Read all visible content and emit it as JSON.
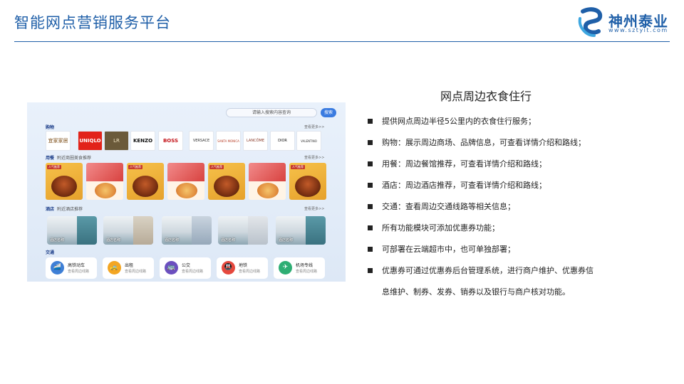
{
  "slide": {
    "title": "智能网点营销服务平台",
    "logo_name": "神州泰业",
    "logo_url": "www.sztyit.com"
  },
  "panel": {
    "search_placeholder": "请输入搜索内容查询",
    "search_button": "搜索",
    "shopping": {
      "label": "购物",
      "more": "查看更多>>",
      "brands": [
        "宜家家居",
        "UNIQLO",
        "LR",
        "KENZO",
        "BOSS",
        "VERSACE",
        "SANTA MONICA",
        "LANCÔME",
        "DIOR",
        "VALENTINO"
      ]
    },
    "dining": {
      "label": "用餐",
      "sub": "附近商圈美食推荐",
      "more": "查看更多>>",
      "tag": "人气推荐",
      "cards": [
        "pot",
        "pizza",
        "pot",
        "pizza",
        "pot",
        "pizza",
        "pot"
      ]
    },
    "hotel": {
      "label": "酒店",
      "sub": "附近酒店推荐",
      "more": "查看更多>>",
      "rooms": [
        "酒店名称",
        "酒店名称",
        "酒店名称",
        "酒店名称",
        "酒店名称"
      ]
    },
    "transport": {
      "label": "交通",
      "items": [
        {
          "title": "高铁动车",
          "sub": "查看周边线路",
          "color": "#3e7fd6",
          "icon": "train-icon",
          "glyph": "🚄"
        },
        {
          "title": "出租",
          "sub": "查看周边线路",
          "color": "#f3a623",
          "icon": "taxi-icon",
          "glyph": "🚕"
        },
        {
          "title": "公交",
          "sub": "查看周边线路",
          "color": "#6b4fbf",
          "icon": "bus-icon",
          "glyph": "🚌"
        },
        {
          "title": "地铁",
          "sub": "查看周边线路",
          "color": "#e5483d",
          "icon": "metro-icon",
          "glyph": "🚇"
        },
        {
          "title": "机场专线",
          "sub": "查看周边线路",
          "color": "#2eae74",
          "icon": "airplane-icon",
          "glyph": "✈"
        }
      ]
    }
  },
  "content": {
    "heading": "网点周边衣食住行",
    "bullets": [
      "提供网点周边半径5公里内的衣食住行服务；",
      "购物：展示周边商场、品牌信息，可查看详情介绍和路线；",
      "用餐：周边餐馆推荐，可查看详情介绍和路线；",
      "酒店：周边酒店推荐，可查看详情介绍和路线；",
      "交通：查看周边交通线路等相关信息；",
      "所有功能模块可添加优惠券功能；",
      "可部署在云端超市中，也可单独部署；",
      "优惠券可通过优惠券后台管理系统，进行商户维护、优惠券信"
    ],
    "bullet_continuation": "息维护、制券、发券、销券以及银行与商户核对功能。"
  }
}
